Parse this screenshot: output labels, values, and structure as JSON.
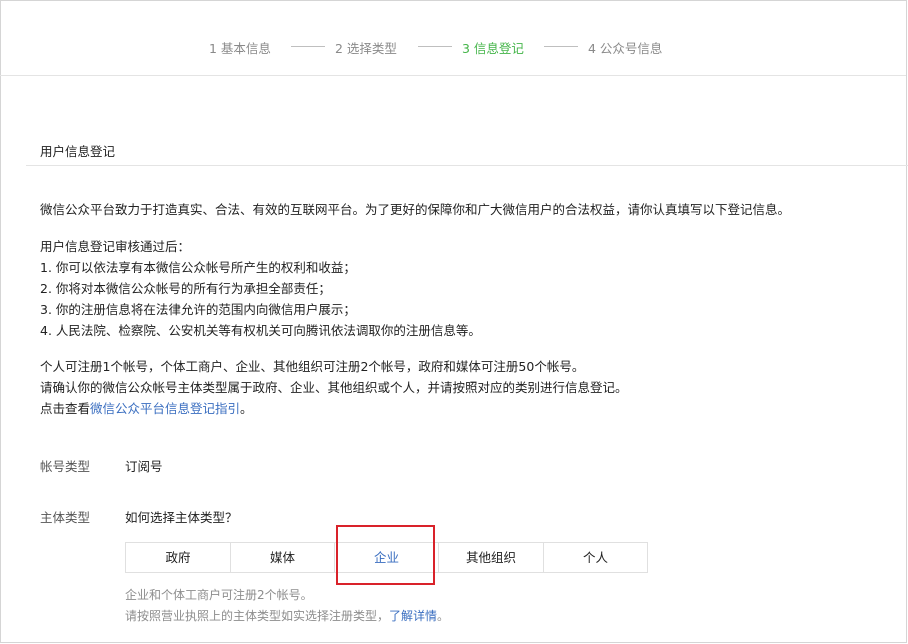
{
  "steps": [
    {
      "label": "1 基本信息",
      "active": false
    },
    {
      "label": "2 选择类型",
      "active": false
    },
    {
      "label": "3 信息登记",
      "active": true
    },
    {
      "label": "4 公众号信息",
      "active": false
    }
  ],
  "section": {
    "title": "用户信息登记"
  },
  "intro": "微信公众平台致力于打造真实、合法、有效的互联网平台。为了更好的保障你和广大微信用户的合法权益，请你认真填写以下登记信息。",
  "rules": {
    "heading": "用户信息登记审核通过后：",
    "items": [
      "1. 你可以依法享有本微信公众帐号所产生的权利和收益；",
      "2. 你将对本微信公众帐号的所有行为承担全部责任；",
      "3. 你的注册信息将在法律允许的范围内向微信用户展示；",
      "4. 人民法院、检察院、公安机关等有权机关可向腾讯依法调取你的注册信息等。"
    ]
  },
  "notes": {
    "line1": "个人可注册1个帐号，个体工商户、企业、其他组织可注册2个帐号，政府和媒体可注册50个帐号。",
    "line2": "请确认你的微信公众帐号主体类型属于政府、企业、其他组织或个人，并请按照对应的类别进行信息登记。",
    "line3_prefix": "点击查看",
    "line3_link": "微信公众平台信息登记指引",
    "line3_suffix": "。"
  },
  "account_type": {
    "label": "帐号类型",
    "value": "订阅号"
  },
  "entity_type": {
    "label": "主体类型",
    "help_link": "如何选择主体类型？",
    "options": [
      "政府",
      "媒体",
      "企业",
      "其他组织",
      "个人"
    ],
    "selected": "企业"
  },
  "hint": {
    "line1": "企业和个体工商户可注册2个帐号。",
    "line2_prefix": "请按照营业执照上的主体类型如实选择注册类型，",
    "line2_link": "了解详情",
    "line2_suffix": "。"
  },
  "colors": {
    "active_step": "#44b549",
    "link": "#3a6ec0",
    "highlight_box": "#d9222a"
  }
}
